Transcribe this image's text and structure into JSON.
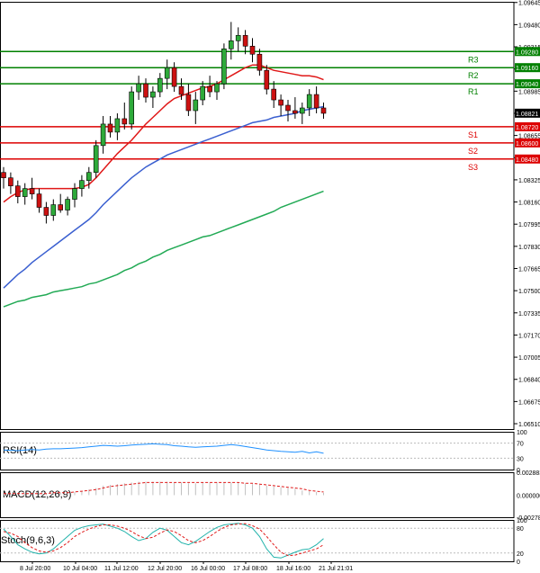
{
  "chart_data": {
    "type": "candlestick",
    "main": {
      "ylim": [
        1.0647,
        1.0965
      ],
      "y_ticks": [
        "1.09645",
        "1.09480",
        "1.09315",
        "1.09150",
        "1.08985",
        "1.08820",
        "1.08655",
        "1.08490",
        "1.08325",
        "1.08160",
        "1.07995",
        "1.07830",
        "1.07665",
        "1.07500",
        "1.07335",
        "1.07170",
        "1.07005",
        "1.06840",
        "1.06675",
        "1.06510"
      ],
      "current_price": "1.08821",
      "levels": [
        {
          "name": "R3",
          "value": 1.0928,
          "label": "1.09280",
          "color": "#008000"
        },
        {
          "name": "R2",
          "value": 1.0916,
          "label": "1.09160",
          "color": "#008000"
        },
        {
          "name": "R1",
          "value": 1.0904,
          "label": "1.09040",
          "color": "#008000"
        },
        {
          "name": "S1",
          "value": 1.0872,
          "label": "1.08720",
          "color": "#dd0000"
        },
        {
          "name": "S2",
          "value": 1.086,
          "label": "1.08600",
          "color": "#dd0000"
        },
        {
          "name": "S3",
          "value": 1.0848,
          "label": "1.08480",
          "color": "#dd0000"
        }
      ],
      "candles": [
        [
          1.0838,
          1.0842,
          1.0826,
          1.0834
        ],
        [
          1.0834,
          1.0838,
          1.0822,
          1.0828
        ],
        [
          1.0828,
          1.0832,
          1.0815,
          1.082
        ],
        [
          1.082,
          1.083,
          1.0814,
          1.0826
        ],
        [
          1.0826,
          1.0834,
          1.0818,
          1.0822
        ],
        [
          1.0822,
          1.0826,
          1.0808,
          1.0812
        ],
        [
          1.0812,
          1.0816,
          1.08,
          1.0806
        ],
        [
          1.0806,
          1.0818,
          1.0802,
          1.0814
        ],
        [
          1.0814,
          1.0822,
          1.0808,
          1.081
        ],
        [
          1.081,
          1.082,
          1.0806,
          1.0818
        ],
        [
          1.0818,
          1.083,
          1.0812,
          1.0826
        ],
        [
          1.0826,
          1.0836,
          1.082,
          1.0832
        ],
        [
          1.0832,
          1.0842,
          1.0826,
          1.0838
        ],
        [
          1.0838,
          1.0862,
          1.0834,
          1.0858
        ],
        [
          1.0858,
          1.088,
          1.0852,
          1.0874
        ],
        [
          1.0874,
          1.088,
          1.0864,
          1.0868
        ],
        [
          1.0868,
          1.0882,
          1.0862,
          1.0878
        ],
        [
          1.0878,
          1.089,
          1.087,
          1.0874
        ],
        [
          1.0874,
          1.0902,
          1.087,
          1.0898
        ],
        [
          1.0898,
          1.091,
          1.0892,
          1.0904
        ],
        [
          1.0904,
          1.0908,
          1.089,
          1.0894
        ],
        [
          1.0894,
          1.0902,
          1.0886,
          1.0898
        ],
        [
          1.0898,
          1.0912,
          1.0894,
          1.0908
        ],
        [
          1.0908,
          1.0922,
          1.09,
          1.0916
        ],
        [
          1.0916,
          1.092,
          1.0898,
          1.0902
        ],
        [
          1.0902,
          1.0908,
          1.0892,
          1.0896
        ],
        [
          1.0896,
          1.0904,
          1.088,
          1.0884
        ],
        [
          1.0884,
          1.0898,
          1.0874,
          1.0892
        ],
        [
          1.0892,
          1.0906,
          1.0888,
          1.0902
        ],
        [
          1.0902,
          1.091,
          1.0894,
          1.0898
        ],
        [
          1.0898,
          1.0906,
          1.0892,
          1.0904
        ],
        [
          1.0904,
          1.0934,
          1.09,
          1.093
        ],
        [
          1.093,
          1.095,
          1.0922,
          1.0936
        ],
        [
          1.0936,
          1.0946,
          1.0928,
          1.094
        ],
        [
          1.094,
          1.0944,
          1.0926,
          1.0932
        ],
        [
          1.0932,
          1.0938,
          1.092,
          1.0926
        ],
        [
          1.0926,
          1.093,
          1.091,
          1.0914
        ],
        [
          1.0914,
          1.0918,
          1.0896,
          1.09
        ],
        [
          1.09,
          1.0906,
          1.0886,
          1.0892
        ],
        [
          1.0892,
          1.0896,
          1.088,
          1.0888
        ],
        [
          1.0888,
          1.0892,
          1.0876,
          1.0884
        ],
        [
          1.0884,
          1.0894,
          1.0878,
          1.0882
        ],
        [
          1.0882,
          1.089,
          1.0874,
          1.0886
        ],
        [
          1.0886,
          1.09,
          1.088,
          1.0896
        ],
        [
          1.0896,
          1.0902,
          1.0882,
          1.0886
        ],
        [
          1.0886,
          1.089,
          1.0878,
          1.0882
        ]
      ],
      "sma_red": [
        1.0816,
        1.082,
        1.0823,
        1.0825,
        1.0826,
        1.0826,
        1.0826,
        1.0826,
        1.0826,
        1.0826,
        1.0826,
        1.0827,
        1.0829,
        1.0834,
        1.084,
        1.0846,
        1.0852,
        1.0857,
        1.0862,
        1.0868,
        1.0874,
        1.0879,
        1.0884,
        1.0889,
        1.0893,
        1.0895,
        1.0897,
        1.0899,
        1.0901,
        1.0902,
        1.0904,
        1.0907,
        1.091,
        1.0913,
        1.0916,
        1.0918,
        1.0918,
        1.0916,
        1.0914,
        1.0913,
        1.0912,
        1.0911,
        1.091,
        1.091,
        1.0909,
        1.0907
      ],
      "sma_blue": [
        1.0752,
        1.0757,
        1.0762,
        1.0766,
        1.0771,
        1.0775,
        1.0779,
        1.0783,
        1.0787,
        1.0791,
        1.0795,
        1.0799,
        1.0803,
        1.0808,
        1.0814,
        1.0819,
        1.0824,
        1.0829,
        1.0834,
        1.0838,
        1.0842,
        1.0845,
        1.0848,
        1.0851,
        1.0853,
        1.0855,
        1.0857,
        1.0859,
        1.0861,
        1.0863,
        1.0865,
        1.0867,
        1.0869,
        1.0871,
        1.0873,
        1.0875,
        1.0876,
        1.0877,
        1.0879,
        1.088,
        1.0881,
        1.0882,
        1.0884,
        1.0885,
        1.0886,
        1.0887
      ],
      "sma_green": [
        1.0738,
        1.074,
        1.0742,
        1.0743,
        1.0745,
        1.0746,
        1.0747,
        1.0749,
        1.075,
        1.0751,
        1.0752,
        1.0753,
        1.0755,
        1.0756,
        1.0758,
        1.076,
        1.0762,
        1.0765,
        1.0767,
        1.077,
        1.0772,
        1.0775,
        1.0777,
        1.078,
        1.0782,
        1.0784,
        1.0786,
        1.0788,
        1.079,
        1.0791,
        1.0793,
        1.0795,
        1.0797,
        1.0799,
        1.0801,
        1.0803,
        1.0805,
        1.0807,
        1.0809,
        1.0812,
        1.0814,
        1.0816,
        1.0818,
        1.082,
        1.0822,
        1.0824
      ]
    },
    "rsi": {
      "label": "RSI(14)",
      "ylim": [
        0,
        100
      ],
      "ticks": [
        "100",
        "70",
        "30",
        "0"
      ],
      "values": [
        52,
        51,
        50,
        52,
        53,
        52,
        54,
        55,
        55,
        56,
        57,
        58,
        60,
        62,
        64,
        63,
        62,
        63,
        65,
        66,
        67,
        68,
        67,
        66,
        63,
        62,
        60,
        59,
        60,
        61,
        62,
        64,
        66,
        64,
        61,
        58,
        55,
        52,
        50,
        48,
        47,
        46,
        48,
        44,
        47,
        43
      ]
    },
    "macd": {
      "label": "MACD(12,26,9)",
      "ticks": [
        "0.002883",
        "0.000000",
        "-0.002783"
      ],
      "ylim": [
        -0.0028,
        0.0029
      ],
      "histogram": [
        0.0002,
        0.0002,
        0.0002,
        0.0002,
        0.0002,
        0.0002,
        0.0002,
        0.0003,
        0.0003,
        0.0003,
        0.0004,
        0.0005,
        0.0007,
        0.0009,
        0.0012,
        0.0013,
        0.0014,
        0.0015,
        0.0016,
        0.0017,
        0.0017,
        0.0017,
        0.0017,
        0.0017,
        0.0016,
        0.0016,
        0.0015,
        0.0015,
        0.0016,
        0.0016,
        0.0016,
        0.0016,
        0.0016,
        0.0016,
        0.0015,
        0.0014,
        0.0013,
        0.0012,
        0.0011,
        0.001,
        0.0009,
        0.0008,
        0.0006,
        0.0005,
        0.0004,
        0.0003
      ],
      "signal": [
        0.0002,
        0.0002,
        0.0002,
        0.0002,
        0.0002,
        0.0002,
        0.0002,
        0.0003,
        0.0003,
        0.0003,
        0.0004,
        0.0005,
        0.0006,
        0.0007,
        0.0009,
        0.0011,
        0.0012,
        0.0013,
        0.0014,
        0.0015,
        0.0016,
        0.0016,
        0.0016,
        0.0016,
        0.0016,
        0.0016,
        0.0016,
        0.0016,
        0.0016,
        0.0016,
        0.0016,
        0.0016,
        0.0016,
        0.0016,
        0.0015,
        0.0015,
        0.0014,
        0.0013,
        0.0012,
        0.0011,
        0.001,
        0.0009,
        0.0008,
        0.0006,
        0.0005,
        0.0004
      ]
    },
    "stoch": {
      "label": "Stoch(9,6,3)",
      "ticks": [
        "100",
        "80",
        "20",
        "0"
      ],
      "ylim": [
        0,
        100
      ],
      "k": [
        78,
        60,
        40,
        30,
        22,
        18,
        20,
        30,
        45,
        60,
        75,
        82,
        86,
        88,
        90,
        85,
        80,
        72,
        60,
        50,
        55,
        70,
        80,
        75,
        60,
        45,
        40,
        48,
        60,
        72,
        82,
        88,
        90,
        92,
        88,
        80,
        60,
        30,
        10,
        8,
        15,
        22,
        28,
        30,
        40,
        55
      ],
      "d": [
        72,
        68,
        60,
        45,
        33,
        25,
        22,
        25,
        33,
        45,
        60,
        70,
        78,
        84,
        88,
        88,
        85,
        80,
        72,
        62,
        55,
        58,
        68,
        76,
        72,
        62,
        50,
        45,
        50,
        60,
        72,
        82,
        88,
        90,
        91,
        86,
        78,
        60,
        40,
        22,
        14,
        15,
        20,
        25,
        30,
        40
      ]
    },
    "x_labels": [
      "8 Jul 20:00",
      "10 Jul 04:00",
      "11 Jul 12:00",
      "12 Jul 20:00",
      "16 Jul 00:00",
      "17 Jul 08:00",
      "18 Jul 16:00",
      "21 Jul 21:01"
    ]
  }
}
